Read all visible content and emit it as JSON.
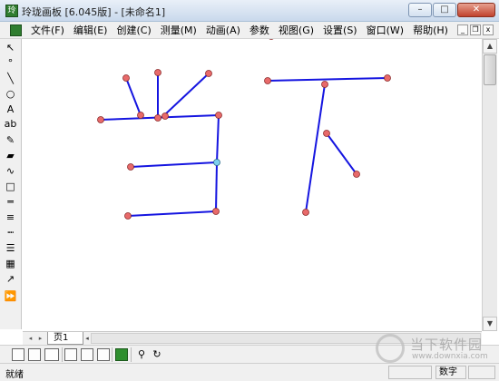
{
  "window": {
    "app_icon_glyph": "玲",
    "title": "玲珑画板 [6.045版] - [未命名1]",
    "buttons": {
      "minimize": "–",
      "maximize": "□",
      "close": "✕"
    }
  },
  "menu": {
    "items": [
      "文件(F)",
      "编辑(E)",
      "创建(C)",
      "测量(M)",
      "动画(A)",
      "参数",
      "视图(G)",
      "设置(S)",
      "窗口(W)",
      "帮助(H)"
    ],
    "mdi_buttons": {
      "minimize": "_",
      "restore": "❒",
      "close": "x"
    }
  },
  "toolbox": {
    "tools": [
      {
        "icon": "arrow-select-icon",
        "glyph": "↖"
      },
      {
        "icon": "point-icon",
        "glyph": "°"
      },
      {
        "icon": "line-icon",
        "glyph": "╲"
      },
      {
        "icon": "circle-icon",
        "glyph": "○"
      },
      {
        "icon": "text-icon",
        "glyph": "A"
      },
      {
        "icon": "label-icon",
        "glyph": "ab"
      },
      {
        "icon": "pen-icon",
        "glyph": "✎"
      },
      {
        "icon": "eraser-icon",
        "glyph": "▰"
      },
      {
        "icon": "curve-icon",
        "glyph": "∿"
      },
      {
        "icon": "rectangle-icon",
        "glyph": "□"
      },
      {
        "icon": "thick-line-icon",
        "glyph": "═"
      },
      {
        "icon": "thin-lines-icon",
        "glyph": "≡"
      },
      {
        "icon": "dotted-lines-icon",
        "glyph": "┉"
      },
      {
        "icon": "line-styles-icon",
        "glyph": "☰"
      },
      {
        "icon": "color-palette-icon",
        "glyph": "▦"
      },
      {
        "icon": "graph-icon",
        "glyph": "↗"
      },
      {
        "icon": "play-animation-icon",
        "glyph": "⏩"
      }
    ]
  },
  "canvas": {
    "line_color": "#1515e0",
    "point_fill": "#e86a6a",
    "highlight_point_fill": "#7fd0ee"
  },
  "page_tabs": {
    "nav_first": "◂",
    "nav_next": "▸",
    "tab_label": "页",
    "tab_number": "1",
    "scroll_left": "◂"
  },
  "status": {
    "left": "就绪",
    "num_indicator": "数字"
  },
  "watermark": {
    "brand": "当下软件园",
    "url": "www.downxia.com"
  }
}
